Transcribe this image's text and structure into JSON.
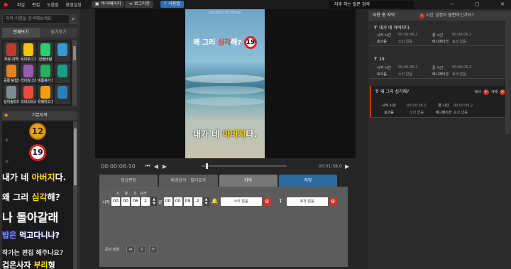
{
  "menu": {
    "items": [
      "파일",
      "편집",
      "도움말",
      "환경설정"
    ],
    "mypage": "마이페이지",
    "logout": "로그아웃",
    "guide": "사용법",
    "faq_search": "자주 하는 질문 검색",
    "window_min": "−",
    "window_max": "□",
    "window_close": "✕"
  },
  "left": {
    "search_placeholder": "자막 이름을 검색해보세요",
    "tab_all": "전체보기",
    "tab_fav": "즐겨찾기",
    "tiles": [
      {
        "label": "무료 자막",
        "color": "#c0392b"
      },
      {
        "label": "브이로그 아이",
        "color": "#f1c40f"
      },
      {
        "label": "산들바람",
        "color": "#2ecc71"
      },
      {
        "label": "",
        "color": "#3498db"
      },
      {
        "label": "공룡 탐험대",
        "color": "#e67e22"
      },
      {
        "label": "라이징 스타",
        "color": "#9b59b6"
      },
      {
        "label": "여름휴가 다",
        "color": "#27ae60"
      },
      {
        "label": "",
        "color": "#16a085"
      },
      {
        "label": "싱어송라이터",
        "color": "#7f8c8d"
      },
      {
        "label": "크리스마스",
        "color": "#e74c3c"
      },
      {
        "label": "유쾌하고 발랄",
        "color": "#f39c12"
      },
      {
        "label": "",
        "color": "#2980b9"
      }
    ],
    "section": "기본자막",
    "stickers": [
      {
        "text": "12"
      },
      {
        "text": "19"
      },
      {
        "text_a": "내가 네 ",
        "text_b": "아버지",
        "text_c": "다."
      },
      {
        "text_a": "왜 그리 ",
        "text_b": "심각",
        "text_c": "해?"
      },
      {
        "text": "나 돌아갈래"
      },
      {
        "text_a": "밥은 ",
        "text_b": "먹고다니냐?"
      },
      {
        "text": "작가는 편집 해주나요?"
      },
      {
        "text_a": "겁은사자 ",
        "text_b": "부리",
        "text_c": "형"
      }
    ]
  },
  "player": {
    "watermark": "youthful for Pause",
    "sub_top_a": "왜 그리 ",
    "sub_top_b": "심각",
    "sub_top_c": "해?",
    "badge": "19",
    "sub_bottom_a": "내가 네 ",
    "sub_bottom_b": "아버지",
    "sub_bottom_c": "다.",
    "current_time": "00:00:06.10",
    "end_time": "00:01:58.0",
    "progress_fraction": 0.05
  },
  "editor": {
    "tabs": [
      "영상편집",
      "배경음악 · 필터효과",
      "자막",
      "저장"
    ],
    "active_tab": "자막",
    "start_label": "시작",
    "time_headers": [
      "시",
      "분",
      "초",
      "프레임"
    ],
    "start": [
      "00",
      "00",
      "06",
      "2"
    ],
    "end_label": "끝",
    "end": [
      "00",
      "00",
      "09",
      "2"
    ],
    "sound": "소리 없음",
    "effect": "효과 없음",
    "align_label": "중앙 정렬"
  },
  "right": {
    "header": "사용 중 자막",
    "warning": "시간 설정이 불편하신가요?",
    "labels": {
      "start": "시작 시간",
      "end": "끝 시간",
      "sfx": "효과음",
      "anim": "애니메이션",
      "none_sound": "소리 없음",
      "none_effect": "효과 없음",
      "copy": "복사",
      "delete": "삭제"
    },
    "cards": [
      {
        "title": "내가 네 아버지다.",
        "start": "00:00:06.2",
        "end": "00:00:06.2"
      },
      {
        "title": "19",
        "start": "00:00:06.2",
        "end": "00:00:06.2"
      },
      {
        "title": "왜 그리 심각해?",
        "start": "00:00:06.2",
        "end": "00:00:09.2"
      }
    ]
  }
}
